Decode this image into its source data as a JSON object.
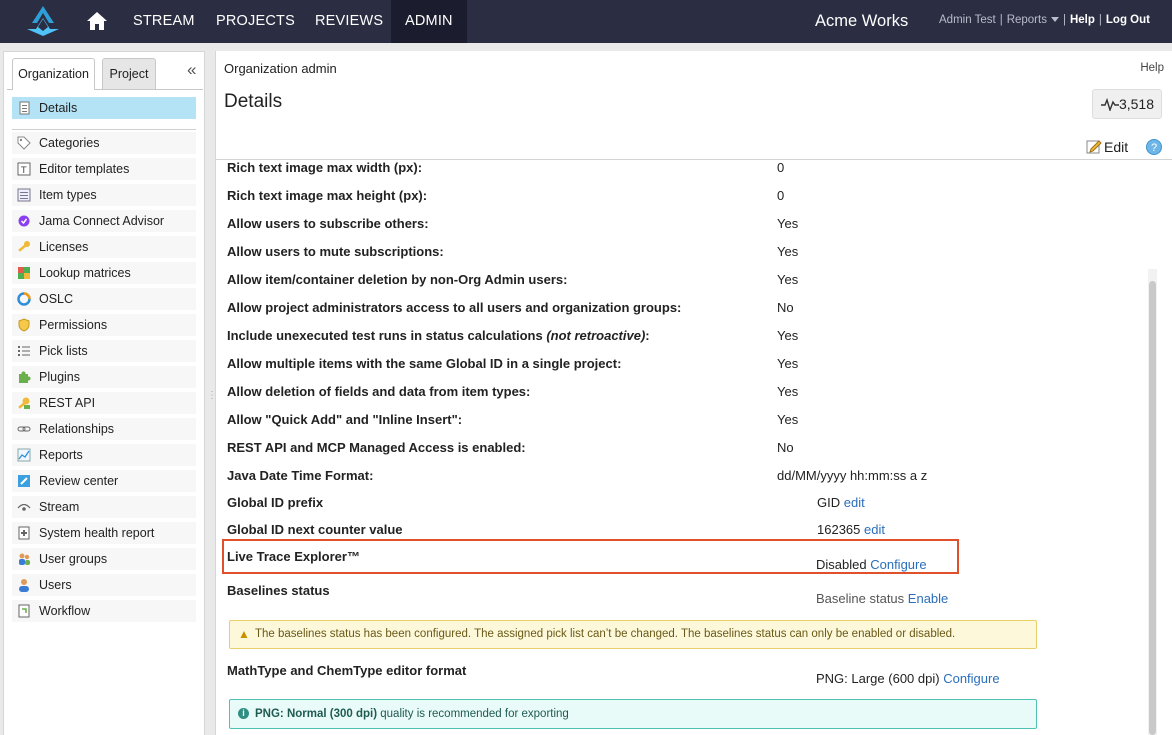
{
  "topbar": {
    "nav": [
      "STREAM",
      "PROJECTS",
      "REVIEWS",
      "ADMIN"
    ],
    "active_nav": "ADMIN",
    "company": "Acme Works",
    "user": "Admin Test",
    "reports": "Reports",
    "help": "Help",
    "logout": "Log Out"
  },
  "sidebar": {
    "tabs": [
      "Organization",
      "Project"
    ],
    "items": [
      {
        "label": "Details",
        "icon": "details-icon"
      },
      {
        "label": "Categories",
        "icon": "tag-icon"
      },
      {
        "label": "Editor templates",
        "icon": "template-icon"
      },
      {
        "label": "Item types",
        "icon": "item-types-icon"
      },
      {
        "label": "Jama Connect Advisor",
        "icon": "advisor-icon"
      },
      {
        "label": "Licenses",
        "icon": "key-icon"
      },
      {
        "label": "Lookup matrices",
        "icon": "matrix-icon"
      },
      {
        "label": "OSLC",
        "icon": "oslc-icon"
      },
      {
        "label": "Permissions",
        "icon": "shield-icon"
      },
      {
        "label": "Pick lists",
        "icon": "list-icon"
      },
      {
        "label": "Plugins",
        "icon": "puzzle-icon"
      },
      {
        "label": "REST API",
        "icon": "api-key-icon"
      },
      {
        "label": "Relationships",
        "icon": "link-icon"
      },
      {
        "label": "Reports",
        "icon": "chart-icon"
      },
      {
        "label": "Review center",
        "icon": "review-icon"
      },
      {
        "label": "Stream",
        "icon": "stream-icon"
      },
      {
        "label": "System health report",
        "icon": "health-icon"
      },
      {
        "label": "User groups",
        "icon": "group-icon"
      },
      {
        "label": "Users",
        "icon": "user-icon"
      },
      {
        "label": "Workflow",
        "icon": "workflow-icon"
      }
    ]
  },
  "main": {
    "breadcrumb": "Organization admin",
    "help": "Help",
    "title": "Details",
    "activity_count": "3,518",
    "edit": "Edit",
    "help_q": "?",
    "rows": [
      {
        "label": "Rich text image max width (px):",
        "value": "0"
      },
      {
        "label": "Rich text image max height (px):",
        "value": "0"
      },
      {
        "label": "Allow users to subscribe others:",
        "value": "Yes"
      },
      {
        "label": "Allow users to mute subscriptions:",
        "value": "Yes"
      },
      {
        "label": "Allow item/container deletion by non-Org Admin users:",
        "value": "Yes"
      },
      {
        "label": "Allow project administrators access to all users and organization groups:",
        "value": "No"
      },
      {
        "label": "Include unexecuted test runs in status calculations",
        "label_note": "(not retroactive)",
        "label_suffix": ":",
        "value": "Yes"
      },
      {
        "label": "Allow multiple items with the same Global ID in a single project:",
        "value": "Yes"
      },
      {
        "label": "Allow deletion of fields and data from item types:",
        "value": "Yes"
      },
      {
        "label": "Allow \"Quick Add\" and \"Inline Insert\":",
        "value": "Yes"
      },
      {
        "label": "REST API and MCP Managed Access is enabled:",
        "value": "No"
      },
      {
        "label": "Java Date Time Format:",
        "value": "dd/MM/yyyy hh:mm:ss a z"
      }
    ],
    "global_id_prefix": {
      "label": "Global ID prefix",
      "value": "GID",
      "link": "edit"
    },
    "global_id_counter": {
      "label": "Global ID next counter value",
      "value": "162365",
      "link": "edit"
    },
    "live_trace": {
      "label": "Live Trace Explorer™",
      "value": "Disabled",
      "link": "Configure"
    },
    "baselines": {
      "label": "Baselines status",
      "value": "Baseline status",
      "link": "Enable"
    },
    "baselines_warning": "The baselines status has been configured. The assigned pick list can’t be changed. The baselines status can only be enabled or disabled.",
    "mathtype": {
      "label": "MathType and ChemType editor format",
      "value": "PNG: Large (600 dpi)",
      "link": "Configure"
    },
    "mathtype_info_bold": "PNG: Normal (300 dpi)",
    "mathtype_info_rest": " quality is recommended for exporting"
  }
}
